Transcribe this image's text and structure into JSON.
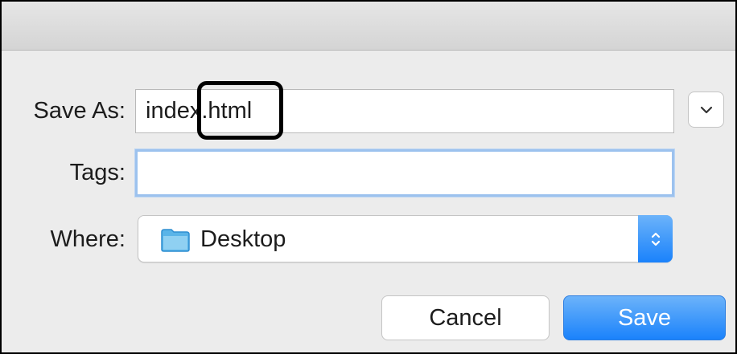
{
  "dialog": {
    "save_as_label": "Save As:",
    "save_as_value": "index.html",
    "tags_label": "Tags:",
    "tags_value": "",
    "where_label": "Where:",
    "where_value": "Desktop",
    "cancel_label": "Cancel",
    "save_label": "Save"
  },
  "icons": {
    "expand": "chevron-down-icon",
    "location": "folder-icon",
    "stepper": "up-down-arrows-icon"
  },
  "colors": {
    "accent": "#1a82fb",
    "focus_ring": "#9cc2ee",
    "folder": "#5ab4e8"
  }
}
